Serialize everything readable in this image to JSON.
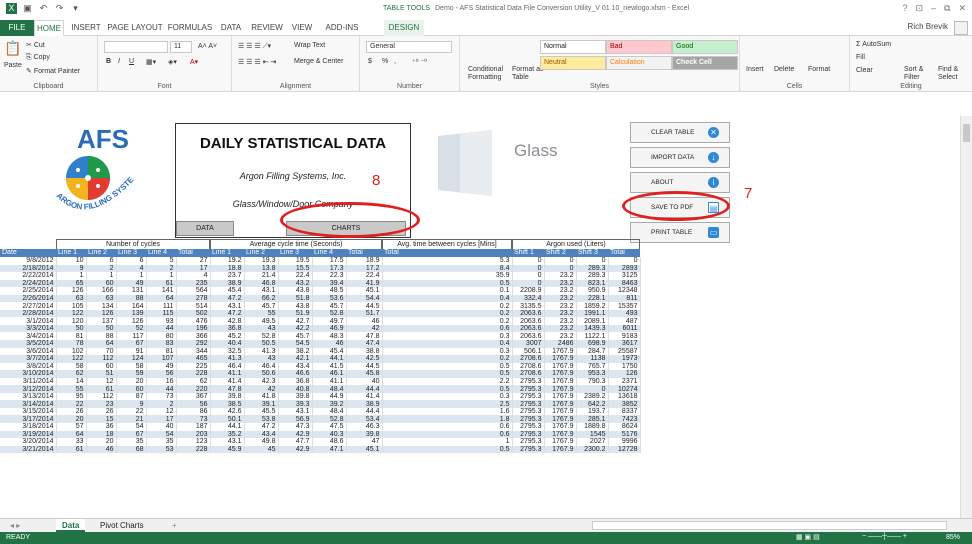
{
  "window": {
    "title": "Demo - AFS Statistical Data File Conversion Utility_V 01 10_newlogo.xlsm - Excel",
    "context_tab_group": "TABLE TOOLS",
    "user": "Rich Brevik",
    "controls": [
      "?",
      "⊡",
      "–",
      "⧉",
      "✕"
    ]
  },
  "ribbon_tabs": [
    "FILE",
    "HOME",
    "INSERT",
    "PAGE LAYOUT",
    "FORMULAS",
    "DATA",
    "REVIEW",
    "VIEW",
    "ADD-INS",
    "DESIGN"
  ],
  "ribbon": {
    "clipboard": {
      "label": "Clipboard",
      "paste": "Paste",
      "cut": "Cut",
      "copy": "Copy",
      "format_painter": "Format Painter"
    },
    "font": {
      "label": "Font",
      "size": "11",
      "bold": "B",
      "italic": "I",
      "underline": "U"
    },
    "alignment": {
      "label": "Alignment",
      "wrap": "Wrap Text",
      "merge": "Merge & Center"
    },
    "number": {
      "label": "Number",
      "format": "General",
      "currency": "$",
      "percent": "%",
      "comma": ","
    },
    "styles": {
      "label": "Styles",
      "conditional": "Conditional Formatting",
      "format_table": "Format as Table",
      "normal": "Normal",
      "bad": "Bad",
      "good": "Good",
      "neutral": "Neutral",
      "calculation": "Calculation",
      "check_cell": "Check Cell"
    },
    "cells": {
      "label": "Cells",
      "insert": "Insert",
      "delete": "Delete",
      "format": "Format"
    },
    "editing": {
      "label": "Editing",
      "autosum": "AutoSum",
      "fill": "Fill",
      "clear": "Clear",
      "sort": "Sort & Filter",
      "find": "Find & Select"
    }
  },
  "sheet": {
    "logo_text": "AFS",
    "logo_ring": "ARGON FILLING SYSTEMS, INC.",
    "title": "DAILY STATISTICAL DATA",
    "company": "Argon Filling Systems, Inc.",
    "company2": "Glass/Window/Door Company",
    "btn_data": "DATA",
    "btn_charts": "CHARTS",
    "glass_label": "Glass",
    "buttons": {
      "clear": "CLEAR TABLE",
      "import": "IMPORT DATA",
      "about": "ABOUT",
      "save_pdf": "SAVE TO PDF",
      "print": "PRINT TABLE"
    },
    "annotations": {
      "a8": "8",
      "a7": "7"
    },
    "group_headers": {
      "cycles": "Number of cycles",
      "avg_cycle": "Average cycle time (Seconds)",
      "avg_between": "Avg. time between cycles [Mins]",
      "argon": "Argon used (Liters)"
    }
  },
  "table": {
    "headers": [
      "Date",
      "Line 1",
      "Line 2",
      "Line 3",
      "Line 4",
      "Total",
      "Line 1",
      "Line 2",
      "Line 3",
      "Line 4",
      "Total",
      "Total",
      "Shift 1",
      "Shift 2",
      "Shift 3",
      "Total"
    ],
    "rows": [
      [
        "9/8/2012",
        "10",
        "6",
        "6",
        "5",
        "27",
        "19.2",
        "19.3",
        "19.5",
        "17.5",
        "18.9",
        "5.3",
        "0",
        "0",
        "0",
        "0"
      ],
      [
        "2/18/2014",
        "9",
        "2",
        "4",
        "2",
        "17",
        "18.8",
        "13.8",
        "15.5",
        "17.3",
        "17.2",
        "8.4",
        "0",
        "0",
        "289.3",
        "2893"
      ],
      [
        "2/22/2014",
        "1",
        "1",
        "1",
        "1",
        "4",
        "23.7",
        "21.4",
        "22.4",
        "22.3",
        "22.4",
        "35.9",
        "0",
        "23.2",
        "289.3",
        "3125"
      ],
      [
        "2/24/2014",
        "65",
        "60",
        "49",
        "61",
        "235",
        "38.9",
        "46.8",
        "43.2",
        "39.4",
        "41.9",
        "0.5",
        "0",
        "23.2",
        "823.1",
        "8463"
      ],
      [
        "2/25/2014",
        "126",
        "166",
        "131",
        "141",
        "564",
        "45.4",
        "43.1",
        "43.8",
        "48.5",
        "45.1",
        "0.1",
        "2208.9",
        "23.2",
        "950.9",
        "12348"
      ],
      [
        "2/26/2014",
        "63",
        "63",
        "88",
        "64",
        "278",
        "47.2",
        "66.2",
        "51.8",
        "53.6",
        "54.4",
        "0.4",
        "332.4",
        "23.2",
        "228.1",
        "811"
      ],
      [
        "2/27/2014",
        "105",
        "134",
        "164",
        "111",
        "514",
        "43.1",
        "45.7",
        "43.8",
        "45.7",
        "44.5",
        "0.2",
        "3135.5",
        "23.2",
        "1859.2",
        "15357"
      ],
      [
        "2/28/2014",
        "122",
        "126",
        "139",
        "115",
        "502",
        "47.2",
        "55",
        "51.9",
        "52.8",
        "51.7",
        "0.2",
        "2063.6",
        "23.2",
        "1991.1",
        "493"
      ],
      [
        "3/1/2014",
        "120",
        "137",
        "126",
        "93",
        "476",
        "42.8",
        "49.5",
        "42.7",
        "49.7",
        "46",
        "0.2",
        "2063.6",
        "23.2",
        "2089.1",
        "487"
      ],
      [
        "3/3/2014",
        "50",
        "50",
        "52",
        "44",
        "196",
        "36.8",
        "43",
        "42.2",
        "46.9",
        "42",
        "0.6",
        "2063.6",
        "23.2",
        "1439.3",
        "6011"
      ],
      [
        "3/4/2014",
        "81",
        "88",
        "117",
        "80",
        "366",
        "45.2",
        "52.8",
        "45.7",
        "48.3",
        "47.8",
        "0.3",
        "2063.6",
        "23.2",
        "1122.1",
        "9183"
      ],
      [
        "3/5/2014",
        "78",
        "64",
        "67",
        "83",
        "292",
        "40.4",
        "50.5",
        "54.5",
        "46",
        "47.4",
        "0.4",
        "3007",
        "2486",
        "698.9",
        "3617"
      ],
      [
        "3/6/2014",
        "102",
        "70",
        "91",
        "81",
        "344",
        "32.5",
        "41.3",
        "38.2",
        "45.4",
        "38.8",
        "0.3",
        "506.1",
        "1767.9",
        "284.7",
        "25587"
      ],
      [
        "3/7/2014",
        "122",
        "112",
        "124",
        "107",
        "465",
        "41.3",
        "43",
        "42.1",
        "44.1",
        "42.5",
        "0.2",
        "2708.6",
        "1767.9",
        "1138",
        "1973"
      ],
      [
        "3/8/2014",
        "58",
        "60",
        "58",
        "49",
        "225",
        "46.4",
        "46.4",
        "43.4",
        "41.5",
        "44.5",
        "0.5",
        "2708.6",
        "1767.9",
        "765.7",
        "1750"
      ],
      [
        "3/10/2014",
        "62",
        "51",
        "59",
        "56",
        "228",
        "41.1",
        "50.6",
        "46.6",
        "46.1",
        "45.8",
        "0.5",
        "2708.6",
        "1767.9",
        "953.3",
        "126"
      ],
      [
        "3/11/2014",
        "14",
        "12",
        "20",
        "16",
        "62",
        "41.4",
        "42.3",
        "36.8",
        "41.1",
        "40",
        "2.2",
        "2795.3",
        "1767.9",
        "790.3",
        "2371"
      ],
      [
        "3/12/2014",
        "55",
        "61",
        "60",
        "44",
        "220",
        "47.8",
        "42",
        "40.8",
        "48.4",
        "44.4",
        "0.5",
        "2795.3",
        "1767.9",
        "0",
        "10274"
      ],
      [
        "3/13/2014",
        "95",
        "112",
        "87",
        "73",
        "367",
        "39.8",
        "41.8",
        "39.8",
        "44.9",
        "41.4",
        "0.3",
        "2795.3",
        "1767.9",
        "2389.2",
        "13618"
      ],
      [
        "3/14/2014",
        "22",
        "23",
        "9",
        "2",
        "56",
        "38.5",
        "39.1",
        "39.3",
        "39.2",
        "38.9",
        "2.5",
        "2795.3",
        "1767.9",
        "642.2",
        "3852"
      ],
      [
        "3/15/2014",
        "26",
        "26",
        "22",
        "12",
        "86",
        "42.6",
        "45.5",
        "43.1",
        "48.4",
        "44.4",
        "1.6",
        "2795.3",
        "1767.9",
        "193.7",
        "8337"
      ],
      [
        "3/17/2014",
        "20",
        "15",
        "21",
        "17",
        "73",
        "50.1",
        "53.8",
        "56.9",
        "52.8",
        "53.4",
        "1.8",
        "2795.3",
        "1767.9",
        "285.1",
        "7423"
      ],
      [
        "3/18/2014",
        "57",
        "36",
        "54",
        "40",
        "187",
        "44.1",
        "47.2",
        "47.3",
        "47.5",
        "46.3",
        "0.6",
        "2795.3",
        "1767.9",
        "1889.8",
        "8624"
      ],
      [
        "3/19/2014",
        "64",
        "18",
        "67",
        "54",
        "203",
        "35.2",
        "43.4",
        "42.9",
        "40.3",
        "39.8",
        "0.6",
        "2795.3",
        "1767.9",
        "1545",
        "5176"
      ],
      [
        "3/20/2014",
        "33",
        "20",
        "35",
        "35",
        "123",
        "43.1",
        "49.8",
        "47.7",
        "48.6",
        "47",
        "1",
        "2795.3",
        "1767.9",
        "2027",
        "9996"
      ],
      [
        "3/21/2014",
        "61",
        "46",
        "68",
        "53",
        "228",
        "45.9",
        "45",
        "42.9",
        "47.1",
        "45.1",
        "0.5",
        "2795.3",
        "1767.9",
        "2300.2",
        "12728"
      ]
    ]
  },
  "sheet_tabs": [
    "Data",
    "Pivot Charts",
    "+"
  ],
  "status": {
    "left": "READY",
    "zoom": "85%"
  }
}
